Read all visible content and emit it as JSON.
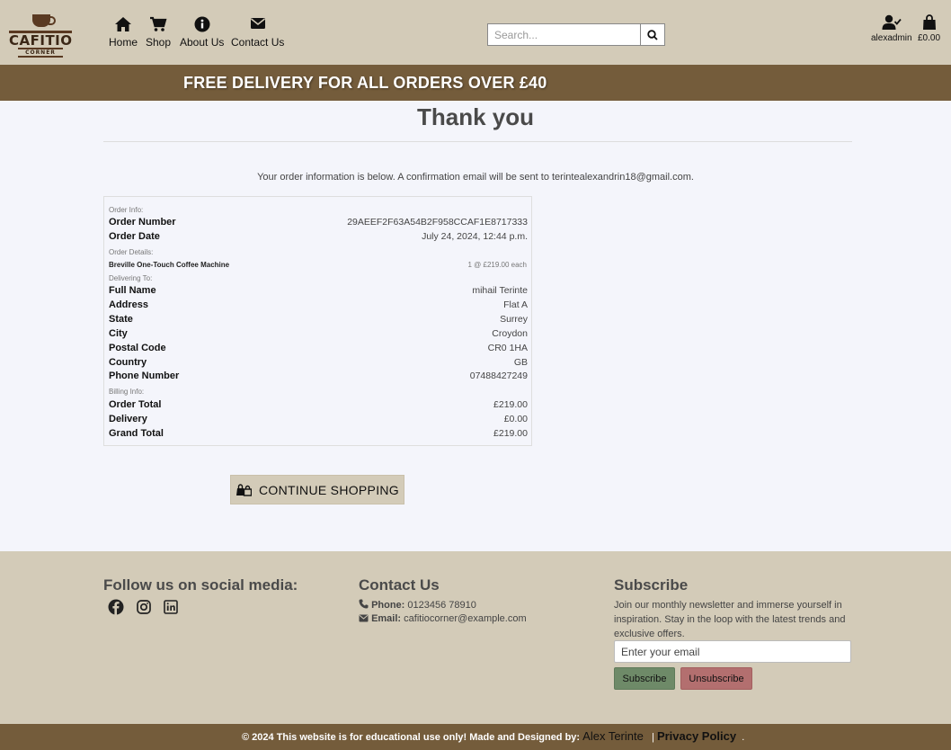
{
  "header": {
    "logo_text": "CAFITIO",
    "logo_sub": "CORNER",
    "nav": [
      {
        "label": "Home",
        "icon": "home-icon"
      },
      {
        "label": "Shop",
        "icon": "cart-icon"
      },
      {
        "label": "About Us",
        "icon": "info-icon"
      },
      {
        "label": "Contact Us",
        "icon": "envelope-icon"
      }
    ],
    "search_placeholder": "Search...",
    "account_label": "alexadmin",
    "bag_total": "£0.00"
  },
  "banner": {
    "text": "FREE DELIVERY FOR ALL ORDERS OVER £40"
  },
  "main": {
    "title": "Thank you",
    "intro": "Your order information is below. A confirmation email will be sent to terintealexandrin18@gmail.com.",
    "order": {
      "info_label": "Order Info:",
      "order_number_label": "Order Number",
      "order_number": "29AEEF2F63A54B2F958CCAF1E8717333",
      "order_date_label": "Order Date",
      "order_date": "July 24, 2024, 12:44 p.m.",
      "details_label": "Order Details:",
      "item_name": "Breville One-Touch Coffee Machine",
      "item_qty": "1 @ £219.00 each",
      "delivering_label": "Delivering To:",
      "full_name_label": "Full Name",
      "full_name": "mihail Terinte",
      "address_label": "Address",
      "address": "Flat A",
      "state_label": "State",
      "state": "Surrey",
      "city_label": "City",
      "city": "Croydon",
      "postcode_label": "Postal Code",
      "postcode": "CR0 1HA",
      "country_label": "Country",
      "country": "GB",
      "phone_label": "Phone Number",
      "phone": "07488427249",
      "billing_label": "Billing Info:",
      "order_total_label": "Order Total",
      "order_total": "£219.00",
      "delivery_label": "Delivery",
      "delivery": "£0.00",
      "grand_total_label": "Grand Total",
      "grand_total": "£219.00"
    },
    "continue_label": "CONTINUE SHOPPING"
  },
  "footer": {
    "social_title": "Follow us on social media:",
    "social_icons": [
      "facebook-icon",
      "instagram-icon",
      "linkedin-icon"
    ],
    "contact_title": "Contact Us",
    "phone_label": "Phone:",
    "phone": "0123456 78910",
    "email_label": "Email:",
    "email": "cafitiocorner@example.com",
    "subscribe_title": "Subscribe",
    "subscribe_text": "Join our monthly newsletter and immerse yourself in inspiration. Stay in the loop with the latest trends and exclusive offers.",
    "email_placeholder": "Enter your email",
    "subscribe_btn": "Subscribe",
    "unsubscribe_btn": "Unsubscribe",
    "copyright": "© 2024 This website is for educational use only! Made and Designed by:",
    "author": "Alex Terinte",
    "separator": "|",
    "privacy": "Privacy Policy",
    "end": "."
  },
  "colors": {
    "header_bg": "#d3cbb8",
    "banner_bg": "#745c3b",
    "page_bg": "#f4f5fb",
    "subscribe_green": "#6e8a68",
    "unsubscribe_red": "#b36f6f"
  }
}
